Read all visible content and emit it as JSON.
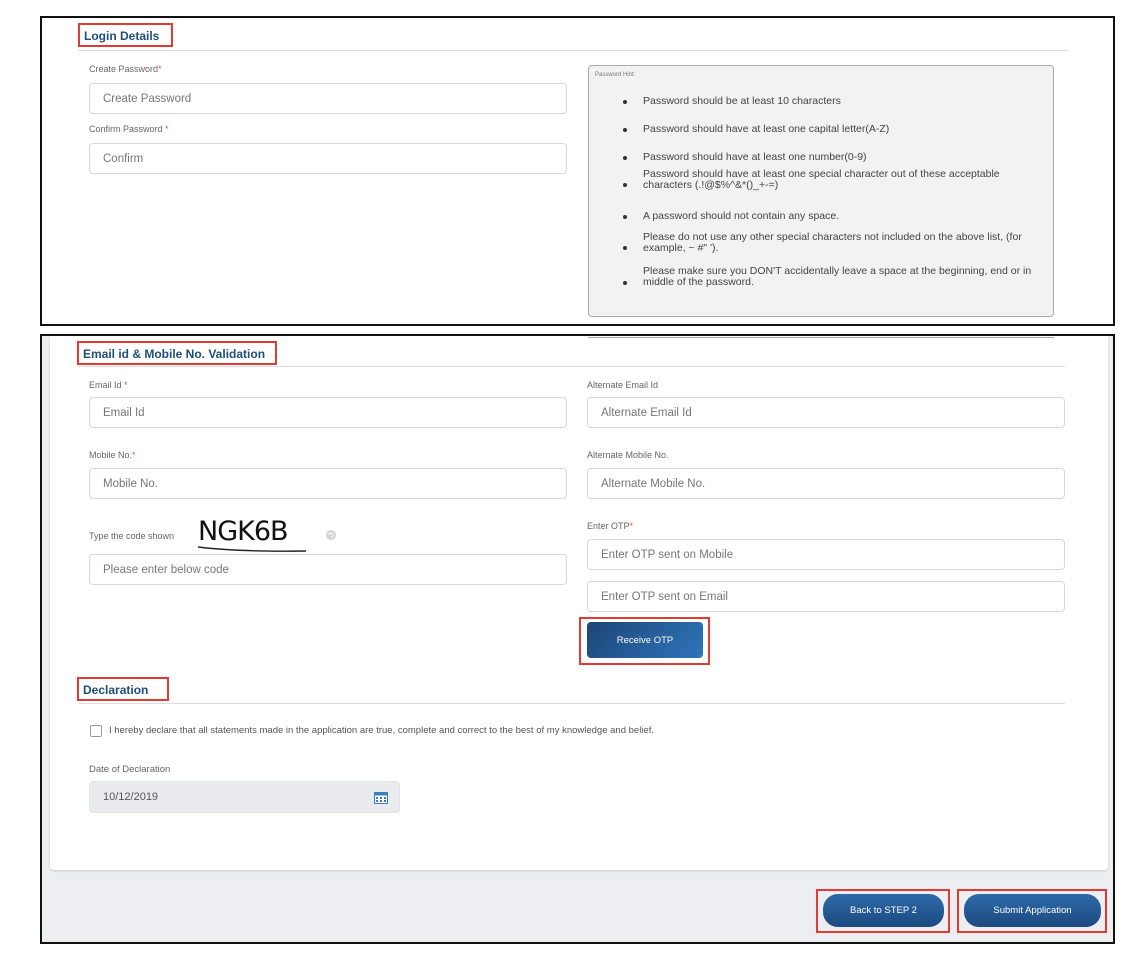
{
  "login": {
    "title": "Login Details",
    "create_password_label": "Create Password",
    "create_password_req": "*",
    "create_password_placeholder": "Create Password",
    "confirm_password_label": "Confirm Password",
    "confirm_password_req": "*",
    "confirm_password_placeholder": "Confirm"
  },
  "password_hint": {
    "title": "Password Hint:",
    "items": [
      "Password should be at least 10 characters",
      "Password should have at least one capital letter(A-Z)",
      "Password should have at least one number(0-9)",
      "Password should have at least one special character out of these acceptable characters (.!@$%^&*()_+-=)",
      "A password should not contain any space.",
      "Please do not use any other special characters not included on the above list, (for example, ~ #\" ').",
      "Please make sure you DON'T accidentally leave a space at the beginning, end or in middle of the password."
    ]
  },
  "validation": {
    "title": "Email id & Mobile No. Validation",
    "email_label": "Email Id",
    "email_req": "*",
    "email_placeholder": "Email Id",
    "alt_email_label": "Alternate Email Id",
    "alt_email_placeholder": "Alternate Email Id",
    "mobile_label": "Mobile No.",
    "mobile_req": "*",
    "mobile_placeholder": "Mobile No.",
    "alt_mobile_label": "Alternate Mobile No.",
    "alt_mobile_placeholder": "Alternate Mobile No.",
    "captcha_label": "Type the code shown",
    "captcha_code": "NGK6B",
    "captcha_placeholder": "Please enter below code",
    "otp_label": "Enter OTP",
    "otp_req": "*",
    "otp_mobile_placeholder": "Enter OTP sent on Mobile",
    "otp_email_placeholder": "Enter OTP sent on Email",
    "receive_otp_label": "Receive OTP"
  },
  "declaration": {
    "title": "Declaration",
    "statement": "I hereby declare that all statements made in the application are true, complete and correct to the best of my knowledge and belief.",
    "date_label": "Date of Declaration",
    "date_value": "10/12/2019"
  },
  "footer": {
    "back_label": "Back to STEP 2",
    "submit_label": "Submit Application"
  },
  "colors": {
    "accent": "#1f4e79",
    "button": "#2a5d96",
    "highlight": "#e23b33"
  }
}
